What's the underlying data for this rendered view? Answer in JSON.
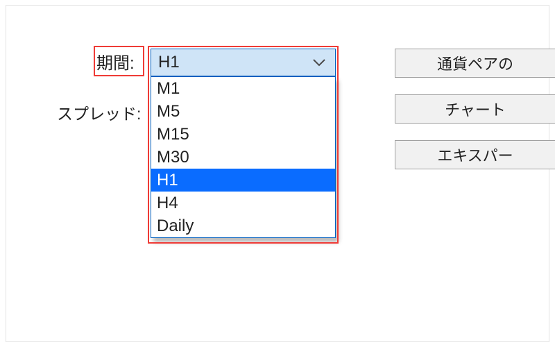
{
  "labels": {
    "period": "期間:",
    "spread": "スプレッド:"
  },
  "period_dropdown": {
    "selected": "H1",
    "options": [
      "M1",
      "M5",
      "M15",
      "M30",
      "H1",
      "H4",
      "Daily"
    ],
    "selected_index": 4
  },
  "buttons": {
    "currency_pair": "通貨ペアの",
    "chart": "チャート",
    "expert": "エキスパー"
  }
}
